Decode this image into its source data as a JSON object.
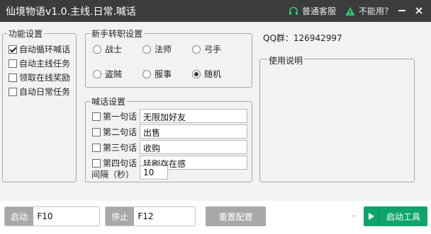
{
  "window": {
    "title": "仙境物语v1.0.主线.日常.喊话",
    "support_label": "普通客服",
    "unusable_label": "不能用？",
    "colors": {
      "titlebar": "#3c3c3c",
      "accent_green": "#0fa56a",
      "panel_bg": "#f2f2f2"
    }
  },
  "features": {
    "title": "功能设置",
    "items": [
      {
        "label": "自动循环喊话",
        "checked": true
      },
      {
        "label": "自动主线任务",
        "checked": false
      },
      {
        "label": "领取在线奖励",
        "checked": false
      },
      {
        "label": "自动日常任务",
        "checked": false
      }
    ]
  },
  "job": {
    "title": "新手转职设置",
    "options": [
      {
        "label": "战士",
        "selected": false
      },
      {
        "label": "法师",
        "selected": false
      },
      {
        "label": "弓手",
        "selected": false
      },
      {
        "label": "盗贼",
        "selected": false
      },
      {
        "label": "服事",
        "selected": false
      },
      {
        "label": "随机",
        "selected": true
      }
    ]
  },
  "shout": {
    "title": "喊话设置",
    "lines": [
      {
        "label": "第一句话",
        "value": "无限加好友",
        "checked": false
      },
      {
        "label": "第二句话",
        "value": "出售",
        "checked": false
      },
      {
        "label": "第三句话",
        "value": "收购",
        "checked": false
      },
      {
        "label": "第四句话",
        "value": "猛刷存在感",
        "checked": false
      }
    ],
    "interval_label": "间隔（秒）",
    "interval_value": "10"
  },
  "qq": {
    "label": "QQ群：",
    "number": "126942997"
  },
  "usage": {
    "title": "使用说明"
  },
  "footer": {
    "start_label": "启动",
    "start_key": "F10",
    "stop_label": "停止",
    "stop_key": "F12",
    "reset_label": "重置配置",
    "dash": "-",
    "launch_label": "启动工具"
  }
}
